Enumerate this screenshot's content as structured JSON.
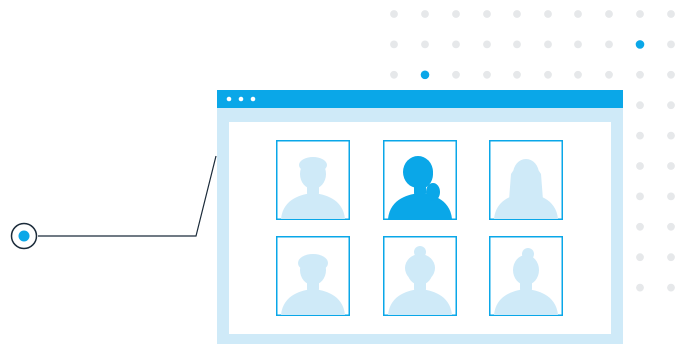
{
  "colors": {
    "accent": "#0aa7e8",
    "light_blue": "#cfeaf8",
    "panel_bg": "#dff1fb",
    "dot_gray": "#e6e8ea",
    "line": "#1b2b3a"
  },
  "browser_window": {
    "control_dots": 3
  },
  "dot_grid": {
    "rows": 10,
    "highlighted_dots": [
      "row-2-col-9",
      "row-3-col-2"
    ]
  },
  "profiles": [
    {
      "id": "profile-1",
      "selected": false
    },
    {
      "id": "profile-2",
      "selected": true
    },
    {
      "id": "profile-3",
      "selected": false
    },
    {
      "id": "profile-4",
      "selected": false
    },
    {
      "id": "profile-5",
      "selected": false
    },
    {
      "id": "profile-6",
      "selected": false
    }
  ]
}
